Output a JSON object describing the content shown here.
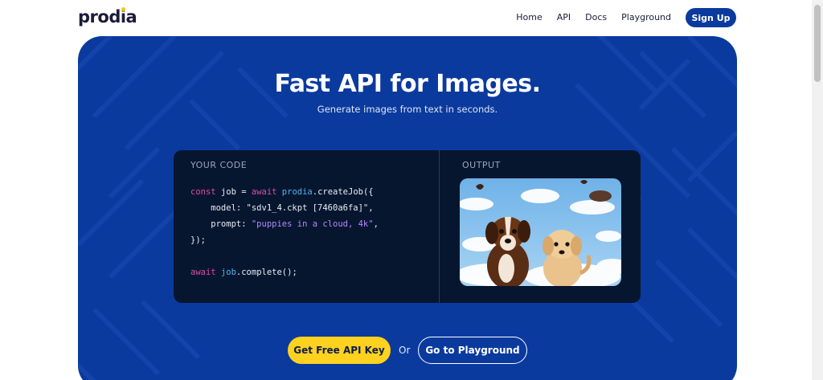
{
  "brand": {
    "name": "prodia",
    "dot_color": "#f5c518"
  },
  "nav": {
    "links": [
      {
        "label": "Home"
      },
      {
        "label": "API"
      },
      {
        "label": "Docs"
      },
      {
        "label": "Playground"
      }
    ],
    "signup_label": "Sign Up"
  },
  "hero": {
    "title": "Fast API for Images.",
    "subtitle": "Generate images from text in seconds.",
    "background": "#0b3a9e"
  },
  "code_panel": {
    "label": "YOUR CODE",
    "lines": [
      {
        "kw": "const",
        "text": " job = ",
        "kw2": "await",
        "fn": " prodia",
        "rest": ".createJob({"
      },
      {
        "text": "    model: \"sdv1_4.ckpt [7460a6fa]\","
      },
      {
        "text": "    prompt: ",
        "str": "\"puppies in a cloud, 4k\"",
        "rest": ","
      },
      {
        "text": "});"
      },
      {
        "text": ""
      },
      {
        "kw": "await",
        "fn": " job",
        "rest": ".complete();"
      }
    ]
  },
  "output_panel": {
    "label": "OUTPUT",
    "image_desc": "two puppies in clouds"
  },
  "cta": {
    "primary_label": "Get Free API Key",
    "or_label": "Or",
    "secondary_label": "Go to Playground",
    "primary_color": "#ffd21f"
  }
}
